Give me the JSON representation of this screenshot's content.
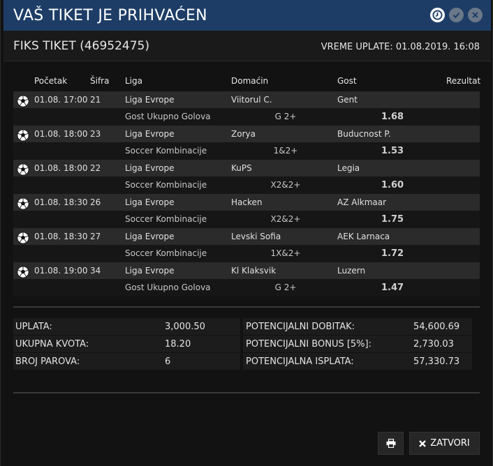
{
  "header": {
    "title": "VAŠ TIKET JE PRIHVAĆEN",
    "icons": [
      "clock-icon",
      "check-circle-icon",
      "close-circle-icon"
    ]
  },
  "ticket": {
    "name": "FIKS TIKET (46952475)",
    "payment_time": "VREME UPLATE: 01.08.2019. 16:08"
  },
  "columns": {
    "start": "Početak",
    "code": "Šifra",
    "league": "Liga",
    "home": "Domaćin",
    "away": "Gost",
    "result": "Rezultat"
  },
  "matches": [
    {
      "time": "01.08. 17:00",
      "code": "21",
      "league": "Liga Evrope",
      "home": "Viitorul C.",
      "away": "Gent",
      "bet_type": "Gost Ukupno Golova",
      "pick": "G 2+",
      "odds": "1.68"
    },
    {
      "time": "01.08. 18:00",
      "code": "23",
      "league": "Liga Evrope",
      "home": "Zorya",
      "away": "Buducnost P.",
      "bet_type": "Soccer Kombinacije",
      "pick": "1&2+",
      "odds": "1.53"
    },
    {
      "time": "01.08. 18:00",
      "code": "22",
      "league": "Liga Evrope",
      "home": "KuPS",
      "away": "Legia",
      "bet_type": "Soccer Kombinacije",
      "pick": "X2&2+",
      "odds": "1.60"
    },
    {
      "time": "01.08. 18:30",
      "code": "26",
      "league": "Liga Evrope",
      "home": "Hacken",
      "away": "AZ Alkmaar",
      "bet_type": "Soccer Kombinacije",
      "pick": "X2&2+",
      "odds": "1.75"
    },
    {
      "time": "01.08. 18:30",
      "code": "27",
      "league": "Liga Evrope",
      "home": "Levski Sofia",
      "away": "AEK Larnaca",
      "bet_type": "Soccer Kombinacije",
      "pick": "1X&2+",
      "odds": "1.72"
    },
    {
      "time": "01.08. 19:00",
      "code": "34",
      "league": "Liga Evrope",
      "home": "Kl Klaksvik",
      "away": "Luzern",
      "bet_type": "Gost Ukupno Golova",
      "pick": "G 2+",
      "odds": "1.47"
    }
  ],
  "summary": {
    "left": [
      {
        "label": "UPLATA:",
        "value": "3,000.50"
      },
      {
        "label": "UKUPNA KVOTA:",
        "value": "18.20"
      },
      {
        "label": "BROJ PAROVA:",
        "value": "6"
      }
    ],
    "right": [
      {
        "label": "POTENCIJALNI DOBITAK:",
        "value": "54,600.69"
      },
      {
        "label": "POTENCIJALNI BONUS [5%]:",
        "value": "2,730.03"
      },
      {
        "label": "POTENCIJALNA ISPLATA:",
        "value": "57,330.73"
      }
    ]
  },
  "buttons": {
    "print_icon": "print-icon",
    "close_label": "ZATVORI"
  },
  "colors": {
    "title_bar": "#1d3d66",
    "row_dark": "#2b2b2b",
    "row_light": "#161616"
  }
}
